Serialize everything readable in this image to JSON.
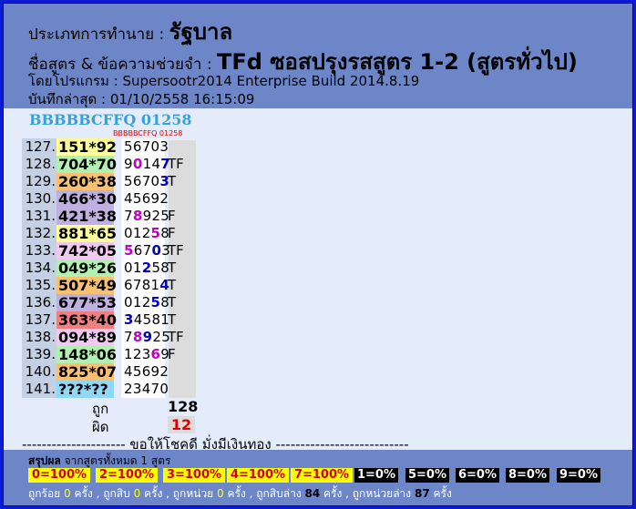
{
  "header": {
    "type_label": "ประเภทการทำนาย : ",
    "type_value": "รัฐบาล",
    "formula_label": "ชื่อสูตร & ข้อความช่วยจำ : ",
    "formula_value": "TFd ซอสปรุงรสสูตร 1-2 (สูตรทั่วไป)",
    "program": "โดยโปรแกรม : Supersootr2014 Enterprise Build 2014.8.19",
    "saved": "บันทึกล่าสุด : 01/10/2558 16:15:09"
  },
  "subtitle": "BBBBBCFFQ 01258",
  "mini_title": "BBBBBCFFQ 01258",
  "rows": [
    {
      "num": "127.",
      "pair": "151*92",
      "color": "#ffff99",
      "result": [
        [
          "5",
          "n"
        ],
        [
          "6",
          "n"
        ],
        [
          "7",
          "n"
        ],
        [
          "0",
          "n"
        ],
        [
          "3",
          "n"
        ]
      ],
      "flag": ""
    },
    {
      "num": "128.",
      "pair": "704*70",
      "color": "#b0f0b0",
      "result": [
        [
          "9",
          "n"
        ],
        [
          "0",
          "p"
        ],
        [
          "1",
          "n"
        ],
        [
          "4",
          "n"
        ],
        [
          "7",
          "b"
        ]
      ],
      "flag": "TF"
    },
    {
      "num": "129.",
      "pair": "260*38",
      "color": "#f8c070",
      "result": [
        [
          "5",
          "n"
        ],
        [
          "6",
          "n"
        ],
        [
          "7",
          "n"
        ],
        [
          "0",
          "n"
        ],
        [
          "3",
          "b"
        ]
      ],
      "flag": "T"
    },
    {
      "num": "130.",
      "pair": "466*30",
      "color": "#c0b0e0",
      "result": [
        [
          "4",
          "n"
        ],
        [
          "5",
          "n"
        ],
        [
          "6",
          "n"
        ],
        [
          "9",
          "n"
        ],
        [
          "2",
          "n"
        ]
      ],
      "flag": ""
    },
    {
      "num": "131.",
      "pair": "421*38",
      "color": "#c0b0e0",
      "result": [
        [
          "7",
          "n"
        ],
        [
          "8",
          "p"
        ],
        [
          "9",
          "n"
        ],
        [
          "2",
          "n"
        ],
        [
          "5",
          "n"
        ]
      ],
      "flag": "F"
    },
    {
      "num": "132.",
      "pair": "881*65",
      "color": "#ffff99",
      "result": [
        [
          "0",
          "n"
        ],
        [
          "1",
          "n"
        ],
        [
          "2",
          "n"
        ],
        [
          "5",
          "p"
        ],
        [
          "8",
          "n"
        ]
      ],
      "flag": "F"
    },
    {
      "num": "133.",
      "pair": "742*05",
      "color": "#f0c8f0",
      "result": [
        [
          "5",
          "p"
        ],
        [
          "6",
          "n"
        ],
        [
          "7",
          "n"
        ],
        [
          "0",
          "b"
        ],
        [
          "3",
          "n"
        ]
      ],
      "flag": "TF"
    },
    {
      "num": "134.",
      "pair": "049*26",
      "color": "#b0f0b0",
      "result": [
        [
          "0",
          "n"
        ],
        [
          "1",
          "n"
        ],
        [
          "2",
          "b"
        ],
        [
          "5",
          "n"
        ],
        [
          "8",
          "n"
        ]
      ],
      "flag": "T"
    },
    {
      "num": "135.",
      "pair": "507*49",
      "color": "#f8c070",
      "result": [
        [
          "6",
          "n"
        ],
        [
          "7",
          "n"
        ],
        [
          "8",
          "n"
        ],
        [
          "1",
          "n"
        ],
        [
          "4",
          "b"
        ]
      ],
      "flag": "T"
    },
    {
      "num": "136.",
      "pair": "677*53",
      "color": "#c0b0e0",
      "result": [
        [
          "0",
          "n"
        ],
        [
          "1",
          "n"
        ],
        [
          "2",
          "n"
        ],
        [
          "5",
          "b"
        ],
        [
          "8",
          "n"
        ]
      ],
      "flag": "T"
    },
    {
      "num": "137.",
      "pair": "363*40",
      "color": "#f08080",
      "result": [
        [
          "3",
          "b"
        ],
        [
          "4",
          "n"
        ],
        [
          "5",
          "n"
        ],
        [
          "8",
          "n"
        ],
        [
          "1",
          "n"
        ]
      ],
      "flag": "T"
    },
    {
      "num": "138.",
      "pair": "094*89",
      "color": "#f0c8f0",
      "result": [
        [
          "7",
          "n"
        ],
        [
          "8",
          "p"
        ],
        [
          "9",
          "b"
        ],
        [
          "2",
          "n"
        ],
        [
          "5",
          "n"
        ]
      ],
      "flag": "TF"
    },
    {
      "num": "139.",
      "pair": "148*06",
      "color": "#b0f0b0",
      "result": [
        [
          "1",
          "n"
        ],
        [
          "2",
          "n"
        ],
        [
          "3",
          "n"
        ],
        [
          "6",
          "p"
        ],
        [
          "9",
          "n"
        ]
      ],
      "flag": "F"
    },
    {
      "num": "140.",
      "pair": "825*07",
      "color": "#f8c070",
      "result": [
        [
          "4",
          "n"
        ],
        [
          "5",
          "n"
        ],
        [
          "6",
          "n"
        ],
        [
          "9",
          "n"
        ],
        [
          "2",
          "n"
        ]
      ],
      "flag": ""
    },
    {
      "num": "141.",
      "pair": "???*??",
      "color": "#90d8f8",
      "result": [
        [
          "2",
          "n"
        ],
        [
          "3",
          "n"
        ],
        [
          "4",
          "n"
        ],
        [
          "7",
          "n"
        ],
        [
          "0",
          "n"
        ]
      ],
      "flag": ""
    }
  ],
  "totals": {
    "correct_label": "ถูก",
    "correct_value": "128",
    "wrong_label": "ผิด",
    "wrong_value": "12"
  },
  "luck_line": "--------------------- ขอให้โชคดี มั่งมีเงินทอง ---------------------------",
  "footer": {
    "summary_label": "สรุปผล",
    "summary_rest": " จากสูตรทั้งหมด 1 สูตร",
    "badges": [
      {
        "text": "0=100%",
        "style": "yellow"
      },
      {
        "text": "2=100%",
        "style": "yellow"
      },
      {
        "text": "3=100%",
        "style": "yellow"
      },
      {
        "text": "4=100%",
        "style": "yellow"
      },
      {
        "text": "7=100%",
        "style": "yellow"
      },
      {
        "text": "1=0%",
        "style": "black"
      },
      {
        "text": "5=0%",
        "style": "black"
      },
      {
        "text": "6=0%",
        "style": "black"
      },
      {
        "text": "8=0%",
        "style": "black"
      },
      {
        "text": "9=0%",
        "style": "black"
      }
    ],
    "stats": [
      {
        "t": "ถูกร้อย ",
        "c": "w"
      },
      {
        "t": "0",
        "c": "n"
      },
      {
        "t": " ครั้ง , ถูกสิบ ",
        "c": "w"
      },
      {
        "t": "0",
        "c": "n"
      },
      {
        "t": " ครั้ง , ถูกหน่วย ",
        "c": "w"
      },
      {
        "t": "0",
        "c": "n"
      },
      {
        "t": " ครั้ง , ถูกสิบล่าง ",
        "c": "w"
      },
      {
        "t": "84",
        "c": "k"
      },
      {
        "t": " ครั้ง , ถูกหน่วยล่าง ",
        "c": "w"
      },
      {
        "t": "87",
        "c": "k"
      },
      {
        "t": " ครั้ง",
        "c": "w"
      }
    ]
  }
}
